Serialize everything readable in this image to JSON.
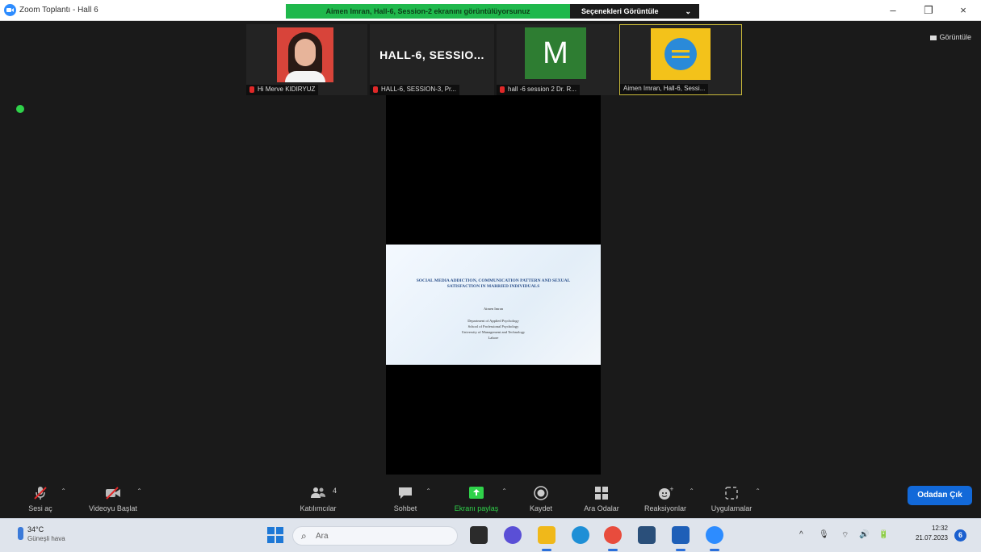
{
  "window": {
    "title": "Zoom Toplantı - Hall 6",
    "minimize": "–",
    "restore": "❐",
    "close": "×"
  },
  "share_banner": {
    "text": "Aimen Imran, Hall-6, Session-2 ekranını görüntülüyorsunuz",
    "view_options": "Seçenekleri Görüntüle",
    "view_options_caret": "⌄"
  },
  "view_button": {
    "label": "Görüntüle"
  },
  "participants": [
    {
      "name": "Hi Merve KIDIRYUZ"
    },
    {
      "name": "HALL-6, SESSION-3, Pr...",
      "tile_title": "HALL-6,  SESSIO..."
    },
    {
      "name": "hall -6 session 2 Dr. R...",
      "avatar_letter": "M"
    },
    {
      "name": "Aimen Imran, Hall-6, Sessi..."
    }
  ],
  "slide": {
    "title": "SOCIAL MEDIA ADDICTION, COMMUNICATION PATTERN AND SEXUAL SATISFACTION IN MARRIED INDIVIDUALS",
    "author": "Aimen Imran",
    "affiliation": [
      "Department of Applied Psychology",
      "School of Professional Psychology",
      "University of Management and Technology",
      "Lahore"
    ]
  },
  "toolbar": {
    "audio": "Sesi aç",
    "video": "Videoyu Başlat",
    "participants": "Katılımcılar",
    "participants_count": "4",
    "chat": "Sohbet",
    "share": "Ekranı paylaş",
    "record": "Kaydet",
    "breakout": "Ara Odalar",
    "reactions": "Reaksiyonlar",
    "apps": "Uygulamalar",
    "caret": "⌃",
    "leave": "Odadan Çık"
  },
  "taskbar": {
    "temperature": "34°C",
    "weather": "Güneşli hava",
    "search_placeholder": "Ara",
    "time": "12:32",
    "date": "21.07.2023",
    "notifications": "6",
    "tray": {
      "chevron": "^",
      "mic": "🎙",
      "wifi": "⌔",
      "volume": "🔊",
      "battery": "🔋"
    }
  },
  "colors": {
    "meeting_bg": "#1a1a1a",
    "share_banner": "#1fb84c",
    "leave_button": "#1269d9",
    "active_green": "#2fd24a",
    "muted_red": "#e02828"
  }
}
